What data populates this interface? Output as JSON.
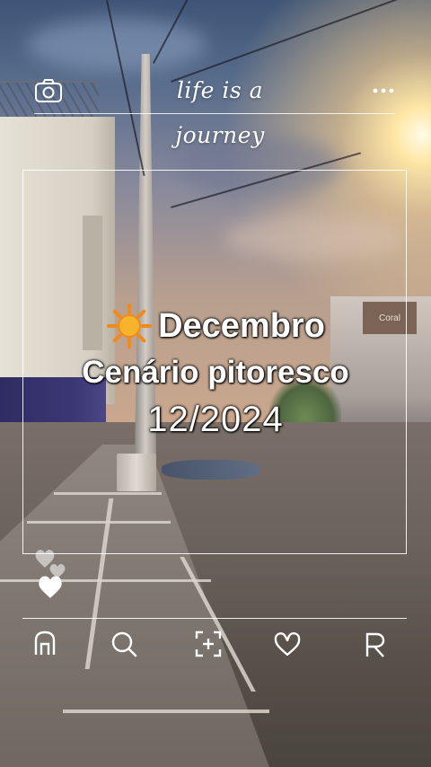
{
  "header": {
    "title": "life is a journey",
    "camera_icon": "camera-icon",
    "more_icon": "more-dots-icon"
  },
  "caption": {
    "line1": "Decembro",
    "line1_emoji": "sun-emoji",
    "line2": "Cenário pitoresco",
    "line3": "12/2024"
  },
  "photo_scene": {
    "sign_text": "Coral"
  },
  "bottom_nav": {
    "items": [
      {
        "icon": "home-icon"
      },
      {
        "icon": "search-icon"
      },
      {
        "icon": "add-frame-icon"
      },
      {
        "icon": "heart-icon"
      },
      {
        "icon": "profile-icon"
      }
    ]
  },
  "colors": {
    "overlay_white": "#ffffff",
    "sun_yellow": "#f7b32b",
    "sun_orange": "#f08a1c"
  }
}
